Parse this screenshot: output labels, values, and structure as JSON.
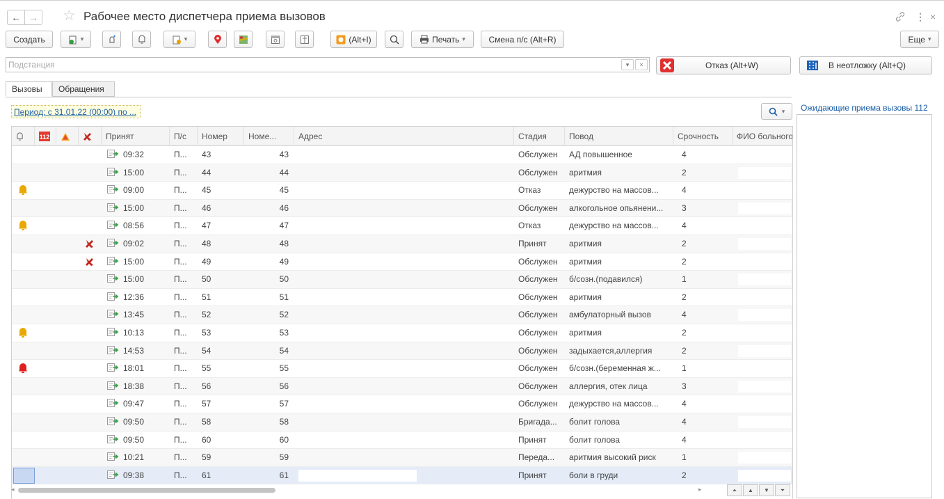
{
  "window": {
    "title": "Рабочее место диспетчера приема вызовов"
  },
  "toolbar": {
    "create_label": "Создать",
    "alt_i_label": "(Alt+I)",
    "print_label": "Печать",
    "change_ps_label": "Смена п/с (Alt+R)",
    "more_label": "Еще"
  },
  "filter": {
    "placeholder": "Подстанция"
  },
  "actions": {
    "refuse_label": "Отказ (Alt+W)",
    "emergency_label": "В неотложку (Alt+Q)"
  },
  "tabs": {
    "calls": "Вызовы",
    "requests": "Обращения"
  },
  "period_label": "Период: с 31.01.22 (00:00) по ...",
  "columns": {
    "accepted": "Принят",
    "ps": "П/с",
    "number": "Номер",
    "number2": "Номе...",
    "address": "Адрес",
    "stage": "Стадия",
    "reason": "Повод",
    "urgency": "Срочность",
    "fio": "ФИО больного"
  },
  "rows": [
    {
      "time": "09:32",
      "ps": "П...",
      "number": "43",
      "number2": "43",
      "stage": "Обслужен",
      "reason": "АД повышенное",
      "urgency": "4",
      "bell": "",
      "ambulance": false
    },
    {
      "time": "15:00",
      "ps": "П...",
      "number": "44",
      "number2": "44",
      "stage": "Обслужен",
      "reason": "аритмия",
      "urgency": "2",
      "bell": "",
      "ambulance": false
    },
    {
      "time": "09:00",
      "ps": "П...",
      "number": "45",
      "number2": "45",
      "stage": "Отказ",
      "reason": "дежурство на массов...",
      "urgency": "4",
      "bell": "yellow",
      "ambulance": false
    },
    {
      "time": "15:00",
      "ps": "П...",
      "number": "46",
      "number2": "46",
      "stage": "Обслужен",
      "reason": "алкогольное опьянени...",
      "urgency": "3",
      "bell": "",
      "ambulance": false
    },
    {
      "time": "08:56",
      "ps": "П...",
      "number": "47",
      "number2": "47",
      "stage": "Отказ",
      "reason": "дежурство на массов...",
      "urgency": "4",
      "bell": "yellow",
      "ambulance": false
    },
    {
      "time": "09:02",
      "ps": "П...",
      "number": "48",
      "number2": "48",
      "stage": "Принят",
      "reason": "аритмия",
      "urgency": "2",
      "bell": "",
      "ambulance": true
    },
    {
      "time": "15:00",
      "ps": "П...",
      "number": "49",
      "number2": "49",
      "stage": "Обслужен",
      "reason": "аритмия",
      "urgency": "2",
      "bell": "",
      "ambulance": true
    },
    {
      "time": "15:00",
      "ps": "П...",
      "number": "50",
      "number2": "50",
      "stage": "Обслужен",
      "reason": "б/созн.(подавился)",
      "urgency": "1",
      "bell": "",
      "ambulance": false
    },
    {
      "time": "12:36",
      "ps": "П...",
      "number": "51",
      "number2": "51",
      "stage": "Обслужен",
      "reason": "аритмия",
      "urgency": "2",
      "bell": "",
      "ambulance": false
    },
    {
      "time": "13:45",
      "ps": "П...",
      "number": "52",
      "number2": "52",
      "stage": "Обслужен",
      "reason": "амбулаторный вызов",
      "urgency": "4",
      "bell": "",
      "ambulance": false
    },
    {
      "time": "10:13",
      "ps": "П...",
      "number": "53",
      "number2": "53",
      "stage": "Обслужен",
      "reason": "аритмия",
      "urgency": "2",
      "bell": "yellow",
      "ambulance": false
    },
    {
      "time": "14:53",
      "ps": "П...",
      "number": "54",
      "number2": "54",
      "stage": "Обслужен",
      "reason": "задыхается,аллергия",
      "urgency": "2",
      "bell": "",
      "ambulance": false
    },
    {
      "time": "18:01",
      "ps": "П...",
      "number": "55",
      "number2": "55",
      "stage": "Обслужен",
      "reason": "б/созн.(беременная ж...",
      "urgency": "1",
      "bell": "red",
      "ambulance": false
    },
    {
      "time": "18:38",
      "ps": "П...",
      "number": "56",
      "number2": "56",
      "stage": "Обслужен",
      "reason": "аллергия, отек лица",
      "urgency": "3",
      "bell": "",
      "ambulance": false
    },
    {
      "time": "09:47",
      "ps": "П...",
      "number": "57",
      "number2": "57",
      "stage": "Обслужен",
      "reason": "дежурство на массов...",
      "urgency": "4",
      "bell": "",
      "ambulance": false
    },
    {
      "time": "09:50",
      "ps": "П...",
      "number": "58",
      "number2": "58",
      "stage": "Бригада...",
      "reason": "болит голова",
      "urgency": "4",
      "bell": "",
      "ambulance": false
    },
    {
      "time": "09:50",
      "ps": "П...",
      "number": "60",
      "number2": "60",
      "stage": "Принят",
      "reason": "болит голова",
      "urgency": "4",
      "bell": "",
      "ambulance": false
    },
    {
      "time": "10:21",
      "ps": "П...",
      "number": "59",
      "number2": "59",
      "stage": "Переда...",
      "reason": "аритмия высокий риск",
      "urgency": "1",
      "bell": "",
      "ambulance": false
    },
    {
      "time": "09:38",
      "ps": "П...",
      "number": "61",
      "number2": "61",
      "stage": "Принят",
      "reason": "боли в груди",
      "urgency": "2",
      "bell": "",
      "ambulance": false
    }
  ],
  "right_panel": {
    "title": "Ожидающие приема вызовы 112"
  },
  "colors": {
    "link": "#1b5fa6",
    "bell_yellow": "#e8a800",
    "bell_red": "#e02020",
    "ambulance_red": "#c0281e",
    "refuse_red": "#e03030",
    "selection": "#e5ecf8"
  }
}
